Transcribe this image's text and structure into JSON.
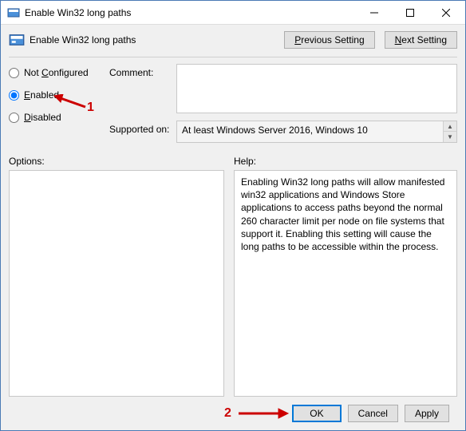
{
  "window": {
    "title": "Enable Win32 long paths"
  },
  "header": {
    "title": "Enable Win32 long paths",
    "prev_label": "Previous Setting",
    "next_label": "Next Setting"
  },
  "radios": {
    "not_configured": "Not Configured",
    "enabled": "Enabled",
    "disabled": "Disabled",
    "selected": "enabled"
  },
  "labels": {
    "comment": "Comment:",
    "supported_on": "Supported on:",
    "options": "Options:",
    "help": "Help:"
  },
  "comment_value": "",
  "supported_text": "At least Windows Server 2016, Windows 10",
  "help_text": "Enabling Win32 long paths will allow manifested win32 applications and Windows Store applications to access paths beyond the normal 260 character limit per node on file systems that support it.  Enabling this setting will cause the long paths to be accessible within the process.",
  "footer": {
    "ok": "OK",
    "cancel": "Cancel",
    "apply": "Apply"
  },
  "annotations": {
    "n1": "1",
    "n2": "2"
  }
}
